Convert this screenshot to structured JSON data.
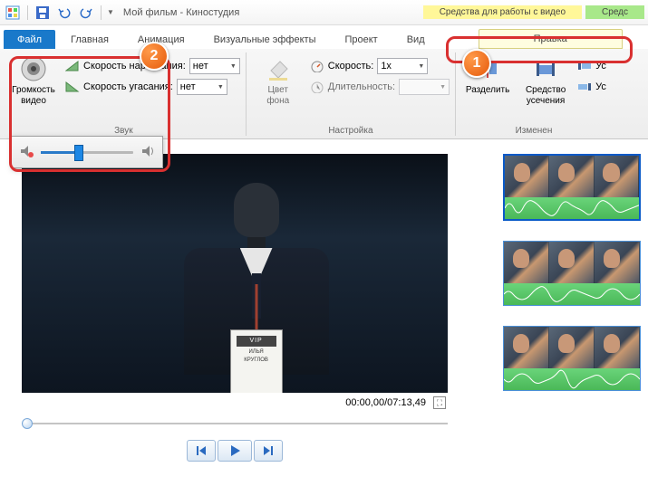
{
  "title": "Мой фильм - Киностудия",
  "context_tabs": {
    "video": "Средства для работы с видео",
    "audio": "Средс"
  },
  "tabs": {
    "file": "Файл",
    "home": "Главная",
    "anim": "Анимация",
    "vfx": "Визуальные эффекты",
    "project": "Проект",
    "view": "Вид",
    "edit": "Правка"
  },
  "ribbon": {
    "volume_label": "Громкость\nвидео",
    "fade_in_label": "Скорость нарастания:",
    "fade_out_label": "Скорость угасания:",
    "fade_value": "нет",
    "audio_group": "Звук",
    "bgcolor_label": "Цвет\nфона",
    "speed_label": "Скорость:",
    "speed_value": "1x",
    "duration_label": "Длительность:",
    "duration_value": "",
    "settings_group": "Настройка",
    "split_label": "Разделить",
    "trim_label": "Средство\nусечения",
    "set_start": "Ус",
    "set_end": "Ус",
    "edit_group": "Изменен"
  },
  "badge": {
    "vip": "VIP",
    "name1": "ИЛЬЯ",
    "name2": "КРУГЛОВ"
  },
  "time": {
    "current": "00:00,00",
    "total": "07:13,49"
  },
  "annotations": {
    "one": "1",
    "two": "2"
  }
}
